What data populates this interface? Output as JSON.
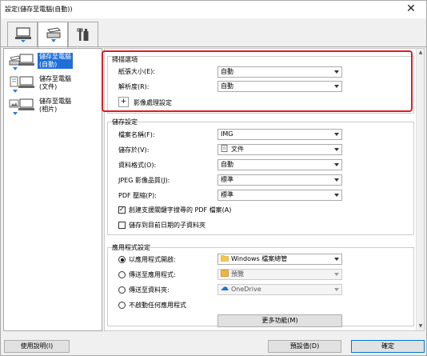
{
  "window": {
    "title": "設定(儲存至電腦(自動))",
    "close_glyph": "✕"
  },
  "tabs": [
    {
      "name": "scan-from-computer",
      "icon": "computer-scan-icon"
    },
    {
      "name": "scan-from-panel",
      "icon": "scanner-icon"
    },
    {
      "name": "general-settings",
      "icon": "tools-icon"
    }
  ],
  "sidebar": {
    "items": [
      {
        "line1": "儲存至電腦",
        "line2": "(自動)",
        "selected": true
      },
      {
        "line1": "儲存至電腦",
        "line2": "(文件)",
        "selected": false
      },
      {
        "line1": "儲存至電腦",
        "line2": "(相片)",
        "selected": false
      }
    ]
  },
  "scan_options": {
    "title": "掃描選項",
    "paper_size_label": "紙張大小(E):",
    "paper_size_value": "自動",
    "resolution_label": "解析度(R):",
    "resolution_value": "自動",
    "image_processing_label": "影像處理設定",
    "expand_glyph": "+"
  },
  "save_settings": {
    "title": "儲存設定",
    "filename_label": "檔案名稱(F):",
    "filename_value": "IMG",
    "save_in_label": "儲存於(V):",
    "save_in_value": "文件",
    "data_format_label": "資料格式(O):",
    "data_format_value": "自動",
    "jpeg_quality_label": "JPEG 影像品質(J):",
    "jpeg_quality_value": "標準",
    "pdf_compression_label": "PDF 壓縮(P):",
    "pdf_compression_value": "標準",
    "keyword_pdf_label": "創建支援關鍵字搜尋的 PDF 檔案(A)",
    "keyword_pdf_checked": true,
    "date_subfolder_label": "儲存到目前日期的子資料夾",
    "date_subfolder_checked": false
  },
  "app_settings": {
    "title": "應用程式設定",
    "open_with_label": "以應用程式開啟:",
    "open_with_value": "Windows 檔案總管",
    "send_to_app_label": "傳送至應用程式:",
    "send_to_app_value": "預覽",
    "send_to_folder_label": "傳送至資料夾:",
    "send_to_folder_value": "OneDrive",
    "no_app_label": "不啟動任何應用程式",
    "more_functions_label": "更多功能(M)",
    "selected_option": "open_with"
  },
  "footer": {
    "help_label": "使用說明(I)",
    "defaults_label": "預設值(D)",
    "ok_label": "確定"
  },
  "colors": {
    "highlight": "#e01a24",
    "selection": "#1e6fd9"
  }
}
